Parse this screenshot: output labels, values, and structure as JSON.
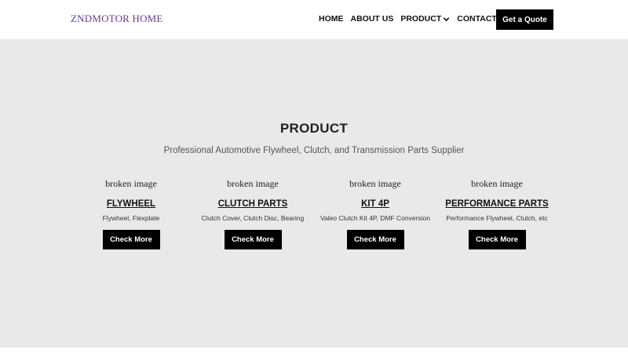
{
  "header": {
    "brand": "ZNDMOTOR HOME",
    "nav": [
      {
        "label": "HOME"
      },
      {
        "label": "ABOUT US"
      },
      {
        "label": "PRODUCT",
        "has_dropdown": true
      },
      {
        "label": "CONTACT"
      }
    ],
    "search_icon": "search-icon",
    "quote_button": "Get a Quote"
  },
  "main": {
    "title": "PRODUCT",
    "subtitle": "Professional Automotive Flywheel, Clutch, and Transmission Parts Supplier",
    "cards": [
      {
        "image_alt": "broken image",
        "title": "FLYWHEEL",
        "description": "Flywheel, Flexplate",
        "button": "Check More"
      },
      {
        "image_alt": "broken image",
        "title": "CLUTCH PARTS",
        "description": "Clutch Cover, Clutch Disc, Bearing",
        "button": "Check More"
      },
      {
        "image_alt": "broken image",
        "title": "KIT 4P",
        "description": "Valeo Clutch Kit 4P, DMF Conversion",
        "button": "Check More"
      },
      {
        "image_alt": "broken image",
        "title": "PERFORMANCE PARTS",
        "description": "Performance Flywheel, Clutch, etc",
        "button": "Check More"
      }
    ]
  },
  "colors": {
    "brand": "#6b3a88",
    "hero_background": "#e9e9ea",
    "button_background": "#000000",
    "button_text": "#ffffff"
  }
}
